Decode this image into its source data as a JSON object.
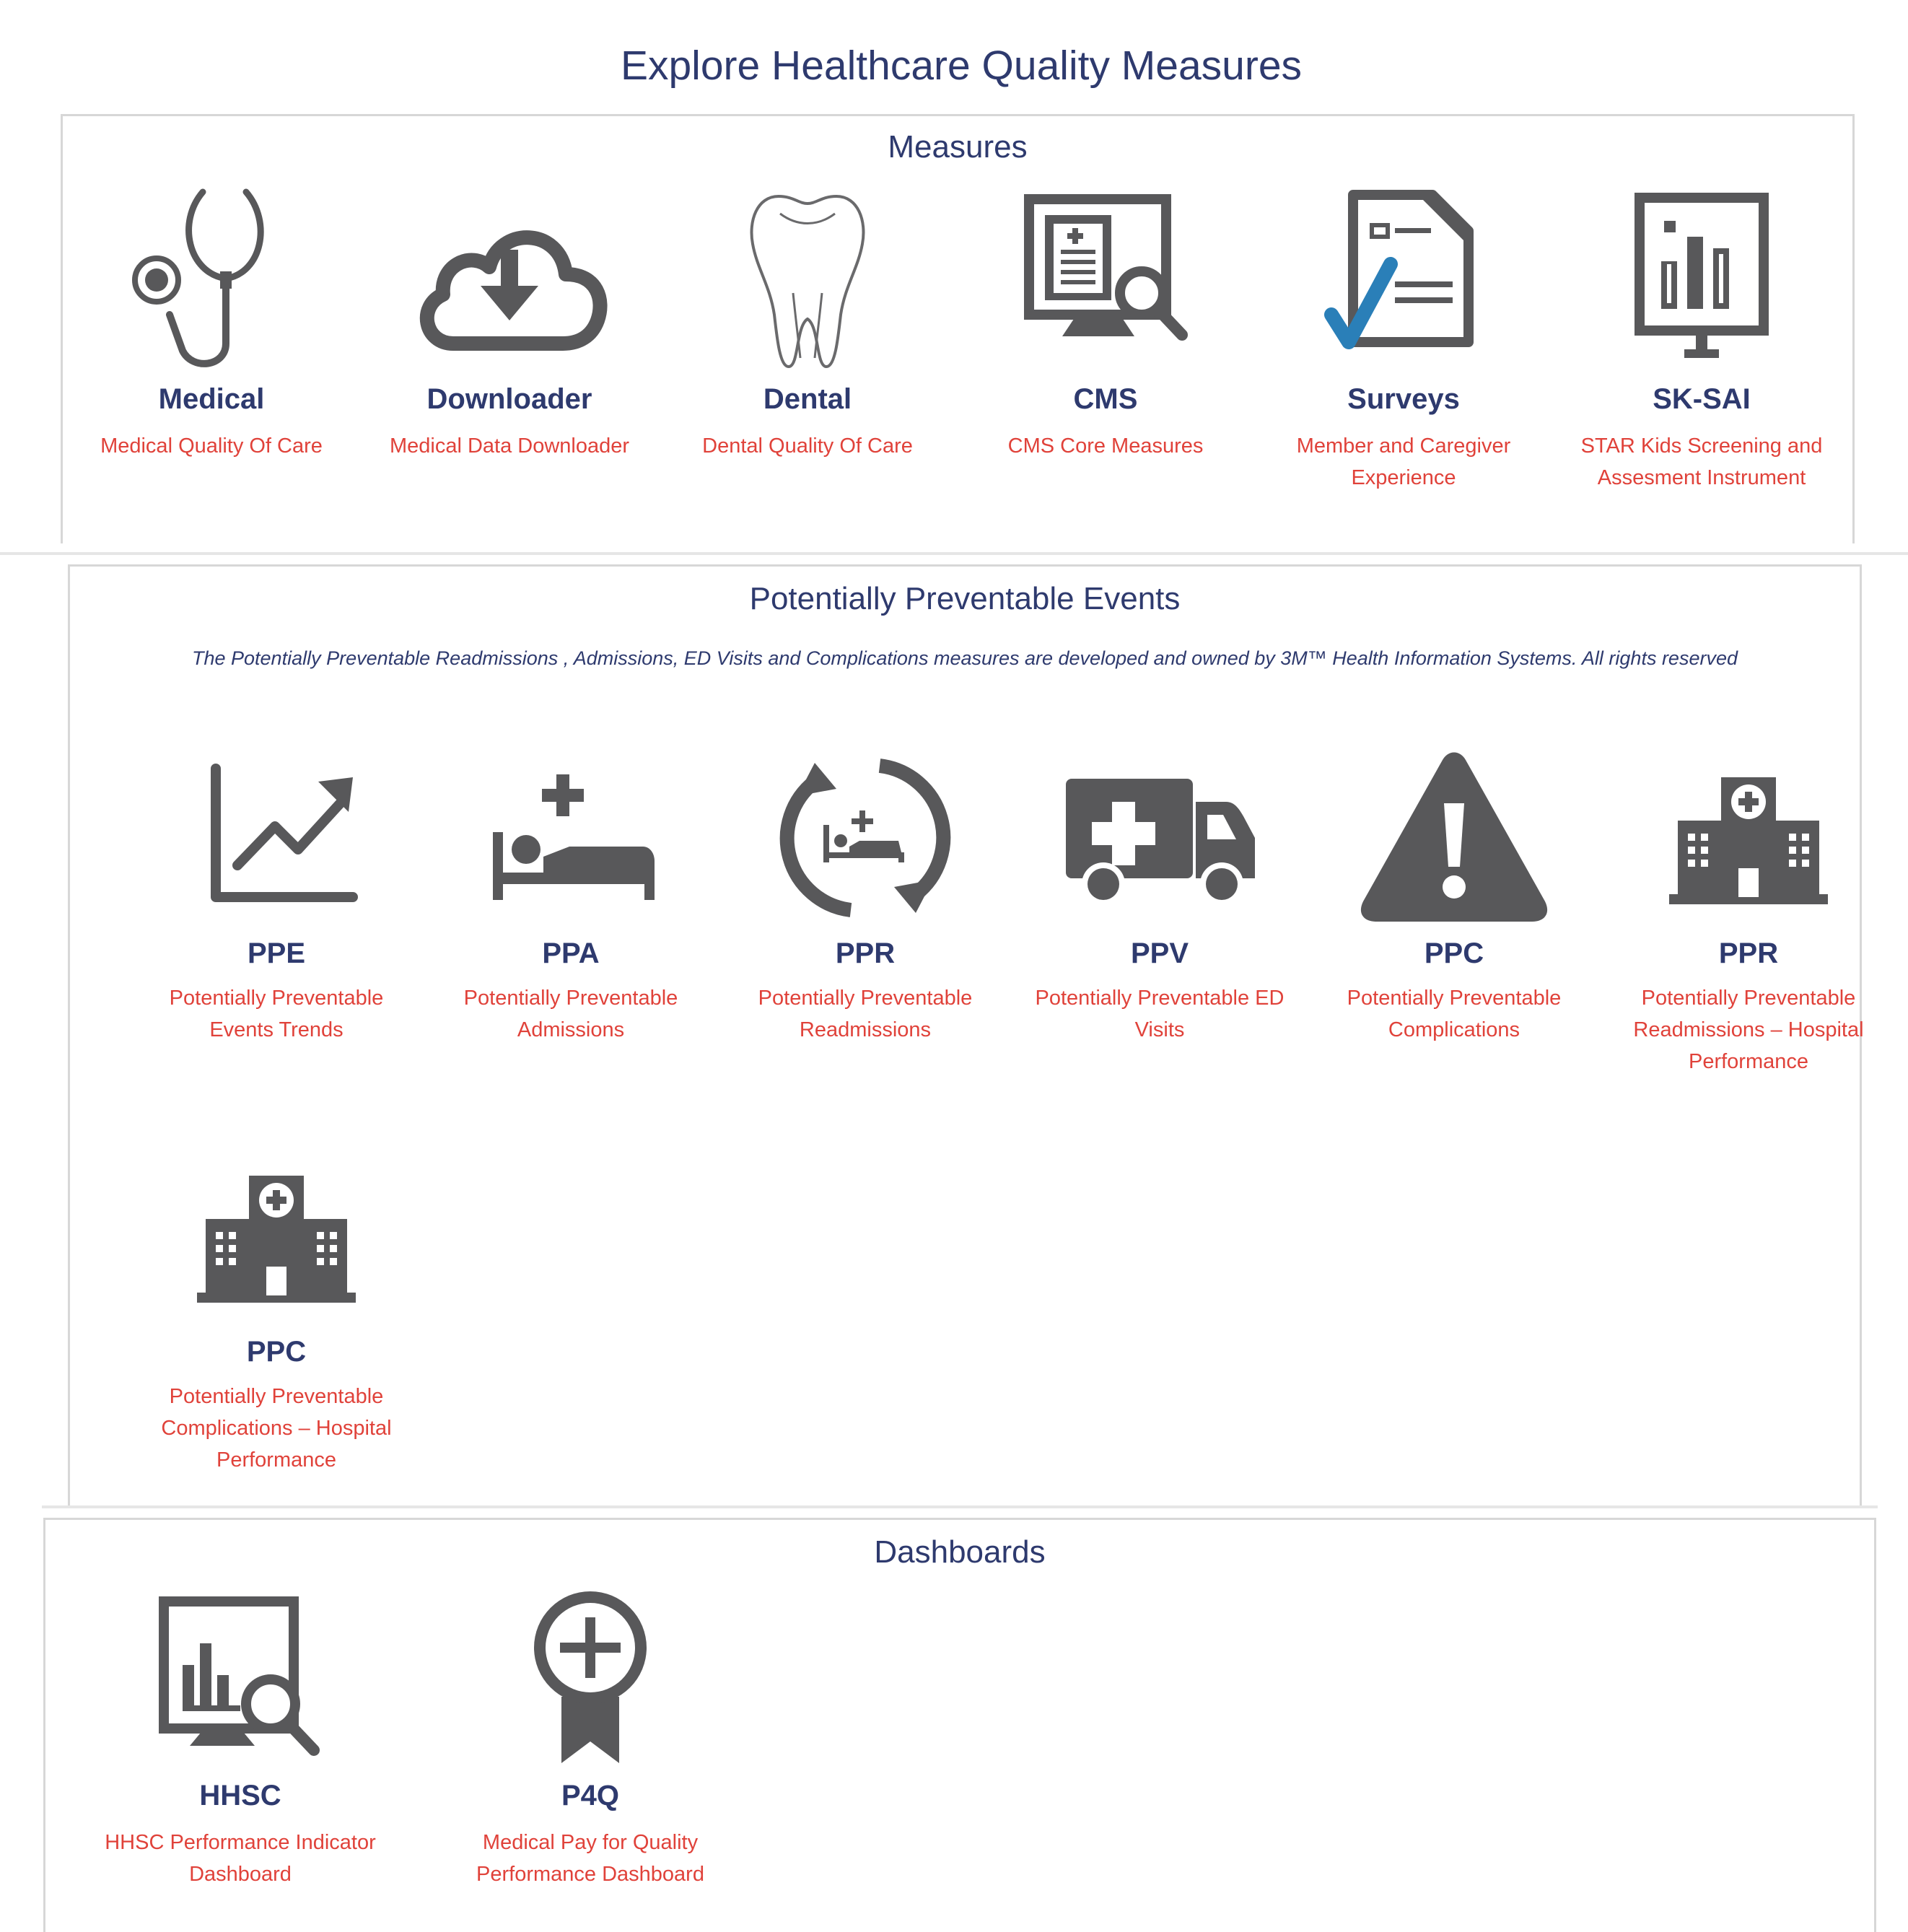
{
  "page": {
    "title": "Explore Healthcare Quality Measures"
  },
  "colors": {
    "title": "#2e3a6e",
    "description": "#e0423a",
    "icon": "#58585a",
    "check": "#2a7fb8",
    "border": "#d7d7d7"
  },
  "sections": {
    "measures": {
      "title": "Measures",
      "items": [
        {
          "title": "Medical",
          "description": "Medical Quality Of  Care",
          "icon": "stethoscope-icon"
        },
        {
          "title": "Downloader",
          "description": "Medical Data Downloader",
          "icon": "cloud-download-icon"
        },
        {
          "title": "Dental",
          "description": "Dental Quality Of Care",
          "icon": "tooth-icon"
        },
        {
          "title": "CMS",
          "description": "CMS Core Measures",
          "icon": "monitor-search-icon"
        },
        {
          "title": "Surveys",
          "description": "Member and Caregiver Experience",
          "icon": "survey-check-icon"
        },
        {
          "title": "SK-SAI",
          "description": "STAR Kids Screening and Assesment Instrument",
          "icon": "presentation-chart-icon"
        }
      ]
    },
    "ppe": {
      "title": "Potentially Preventable Events",
      "notice": "The Potentially Preventable Readmissions , Admissions, ED Visits and Complications measures are developed and owned by 3M™ Health Information Systems. All rights reserved",
      "items": [
        {
          "title": "PPE",
          "description": "Potentially Preventable Events Trends",
          "icon": "trend-chart-icon"
        },
        {
          "title": "PPA",
          "description": "Potentially Preventable Admissions",
          "icon": "hospital-bed-icon"
        },
        {
          "title": "PPR",
          "description": "Potentially Preventable Readmissions",
          "icon": "readmission-cycle-icon"
        },
        {
          "title": "PPV",
          "description": "Potentially Preventable ED Visits",
          "icon": "ambulance-icon"
        },
        {
          "title": "PPC",
          "description": "Potentially Preventable Complications",
          "icon": "warning-icon"
        },
        {
          "title": "PPR",
          "description": "Potentially Preventable Readmissions – Hospital Performance",
          "icon": "hospital-building-icon"
        },
        {
          "title": "PPC",
          "description": "Potentially Preventable Complications – Hospital Performance",
          "icon": "hospital-building-icon"
        }
      ]
    },
    "dashboards": {
      "title": "Dashboards",
      "items": [
        {
          "title": "HHSC",
          "description": "HHSC Performance Indicator Dashboard",
          "icon": "dashboard-search-icon"
        },
        {
          "title": "P4Q",
          "description": "Medical Pay for Quality Performance Dashboard",
          "icon": "award-ribbon-icon"
        }
      ]
    }
  }
}
